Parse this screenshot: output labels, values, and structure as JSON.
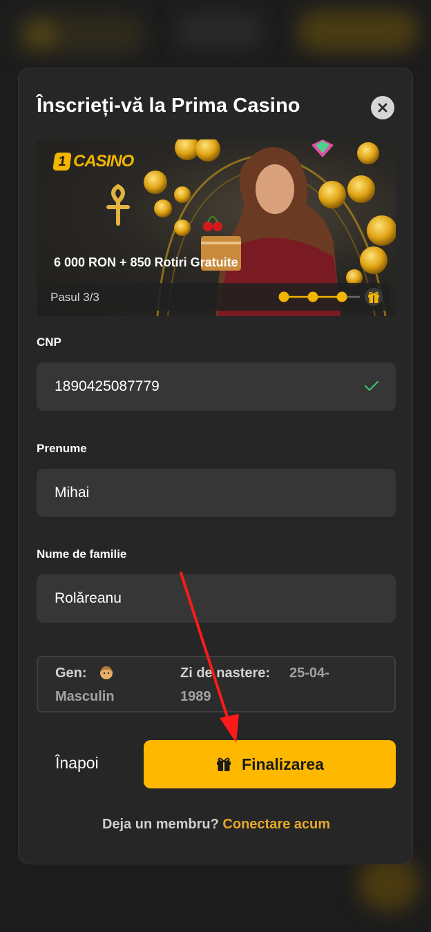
{
  "modal": {
    "title": "Înscrieți-vă la Prima Casino"
  },
  "banner": {
    "logo_digit": "1",
    "logo_text": "CASINO",
    "promo": "6 000 RON + 850 Rotiri Gratuite",
    "step_label": "Pasul 3/3",
    "steps_total": 4,
    "steps_completed": 3
  },
  "form": {
    "cnp": {
      "label": "CNP",
      "value": "1890425087779",
      "valid": true
    },
    "prenume": {
      "label": "Prenume",
      "value": "Mihai"
    },
    "nume": {
      "label": "Nume de familie",
      "value": "Rolăreanu"
    }
  },
  "info": {
    "gender_label": "Gen:",
    "gender_value": "Masculin",
    "birth_label": "Zi de nastere:",
    "birth_value_part1": "25-04-",
    "birth_value_part2": "1989"
  },
  "actions": {
    "back_label": "Înapoi",
    "finish_label": "Finalizarea"
  },
  "footer": {
    "member_question": "Deja un membru?",
    "login_link": "Conectare acum"
  },
  "colors": {
    "accent": "#ffb800",
    "link": "#e6a72c",
    "valid": "#3fbf6a",
    "annotation_arrow": "#ff1a1a"
  },
  "icons": {
    "close": "close-icon",
    "check": "check-icon",
    "gift": "gift-icon",
    "avatar": "male-avatar-icon"
  }
}
